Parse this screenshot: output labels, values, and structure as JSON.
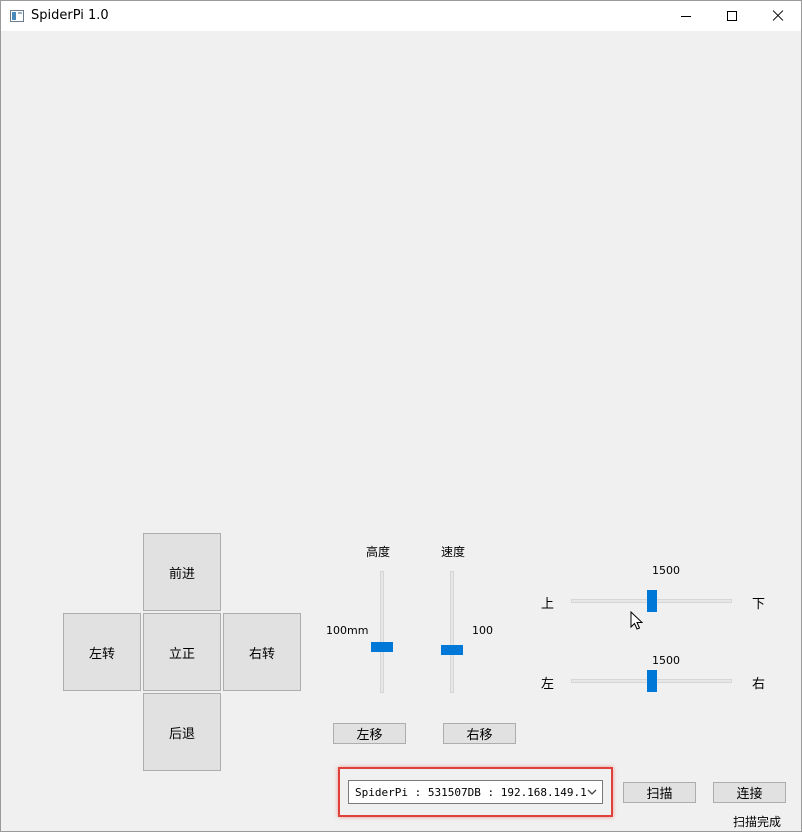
{
  "window": {
    "title": "SpiderPi 1.0",
    "icons": {
      "app": "app-window-icon",
      "minimize": "minimize-icon",
      "maximize": "maximize-icon",
      "close": "close-icon"
    }
  },
  "dpad": {
    "forward": "前进",
    "turn_left": "左转",
    "stand": "立正",
    "turn_right": "右转",
    "backward": "后退"
  },
  "height_slider": {
    "title": "高度",
    "value_label": "100mm",
    "level": 0.38
  },
  "speed_slider": {
    "title": "速度",
    "value_label": "100",
    "level": 0.35
  },
  "pitch_slider": {
    "value_label": "1500",
    "start_label": "上",
    "end_label": "下",
    "level": 0.5
  },
  "yaw_slider": {
    "value_label": "1500",
    "start_label": "左",
    "end_label": "右",
    "level": 0.5
  },
  "move_buttons": {
    "left": "左移",
    "right": "右移"
  },
  "device_select": {
    "selected": "SpiderPi : 531507DB : 192.168.149.1",
    "highlight_color": "#e0403a"
  },
  "actions": {
    "scan": "扫描",
    "connect": "连接"
  },
  "status": {
    "text": "扫描完成"
  },
  "colors": {
    "accent": "#0078d7",
    "background": "#f0f0f0"
  }
}
